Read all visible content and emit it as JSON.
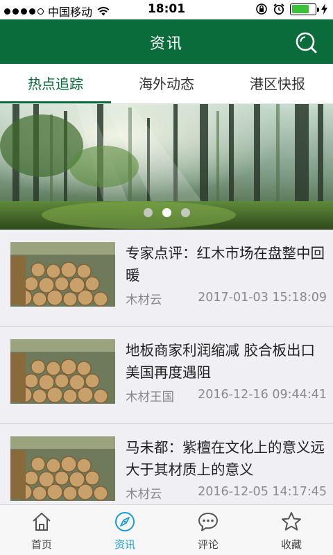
{
  "status_bar": {
    "carrier": "中国移动",
    "time": "18:01",
    "signal_bars_filled": 4,
    "signal_bars_total": 5,
    "battery_level_fraction": 0.75,
    "icons": [
      "signal-dots-icon",
      "wifi-icon",
      "rotation-lock-icon",
      "alarm-icon",
      "battery-icon",
      "charging-icon"
    ]
  },
  "header": {
    "title": "资讯",
    "search_icon": "search-icon",
    "background_color": "#0a6b3b"
  },
  "tabs": [
    {
      "label": "热点追踪",
      "active": true
    },
    {
      "label": "海外动态",
      "active": false
    },
    {
      "label": "港区快报",
      "active": false
    }
  ],
  "banner": {
    "image": "forest-sunlight-image",
    "slide_count": 3,
    "active_slide": 2
  },
  "news": [
    {
      "title": "专家点评：红木市场在盘整中回暖",
      "source": "木材云",
      "datetime": "2017-01-03 15:18:09",
      "thumbnail": "log-pile-image"
    },
    {
      "title": "地板商家利润缩减 胶合板出口美国再度遇阻",
      "source": "木材王国",
      "datetime": "2016-12-16 09:44:41",
      "thumbnail": "log-pile-image"
    },
    {
      "title": "马未都：紫檀在文化上的意义远大于其材质上的意义",
      "source": "木材云",
      "datetime": "2016-12-05 14:17:45",
      "thumbnail": "log-pile-image"
    }
  ],
  "tabbar": [
    {
      "label": "首页",
      "icon": "home-icon",
      "active": false
    },
    {
      "label": "资讯",
      "icon": "compass-icon",
      "active": true
    },
    {
      "label": "评论",
      "icon": "chat-bubble-icon",
      "active": false
    },
    {
      "label": "收藏",
      "icon": "star-icon",
      "active": false
    }
  ],
  "colors": {
    "brand_green": "#0a6b3b",
    "active_tab_blue": "#1a9bd7"
  }
}
